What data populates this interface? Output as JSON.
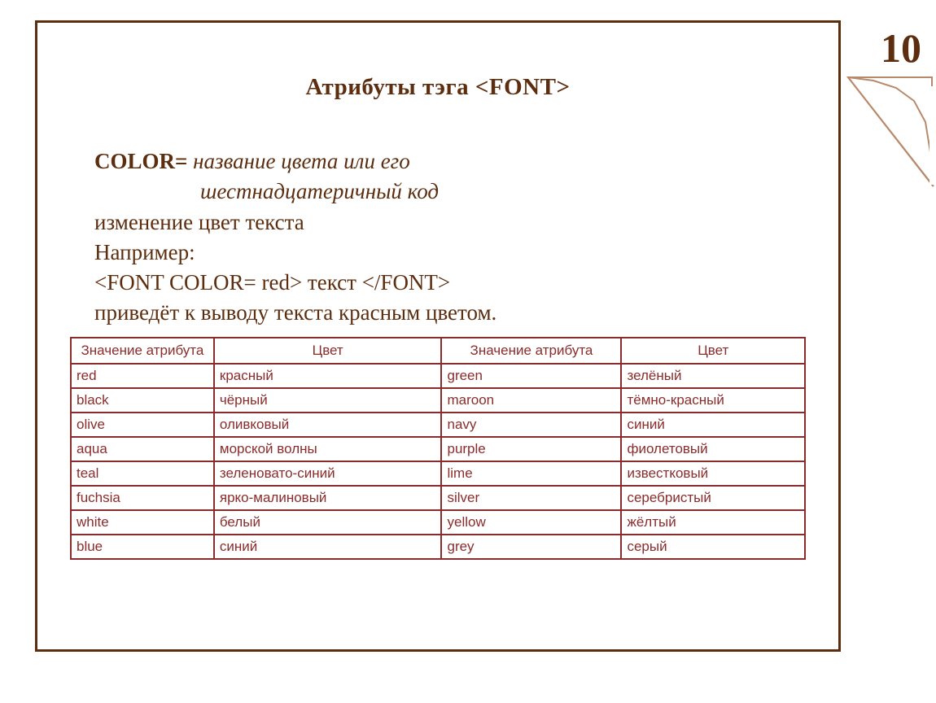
{
  "page_number": "10",
  "title": "Атрибуты тэга <FONT>",
  "attr": {
    "name": "COLOR=",
    "desc_line1": " название цвета  или его",
    "desc_line2": "шестнадцатеричный код"
  },
  "text": {
    "meaning": "изменение цвет текста",
    "example_label": "Например:",
    "example_code": "<FONT  COLOR= red>  текст </FONT>",
    "result": "приведёт к выводу текста красным цветом."
  },
  "table": {
    "headers": [
      "Значение атрибута",
      "Цвет",
      "Значение атрибута",
      "Цвет"
    ],
    "rows": [
      [
        "red",
        "красный",
        "green",
        "зелёный"
      ],
      [
        "black",
        "чёрный",
        "maroon",
        "тёмно-красный"
      ],
      [
        "olive",
        "оливковый",
        "navy",
        "синий"
      ],
      [
        "aqua",
        "морской волны",
        "purple",
        "фиолетовый"
      ],
      [
        "teal",
        "зеленовато-синий",
        "lime",
        "известковый"
      ],
      [
        "fuchsia",
        "ярко-малиновый",
        "silver",
        "серебристый"
      ],
      [
        "white",
        "белый",
        "yellow",
        "жёлтый"
      ],
      [
        "blue",
        "синий",
        "grey",
        "серый"
      ]
    ]
  }
}
